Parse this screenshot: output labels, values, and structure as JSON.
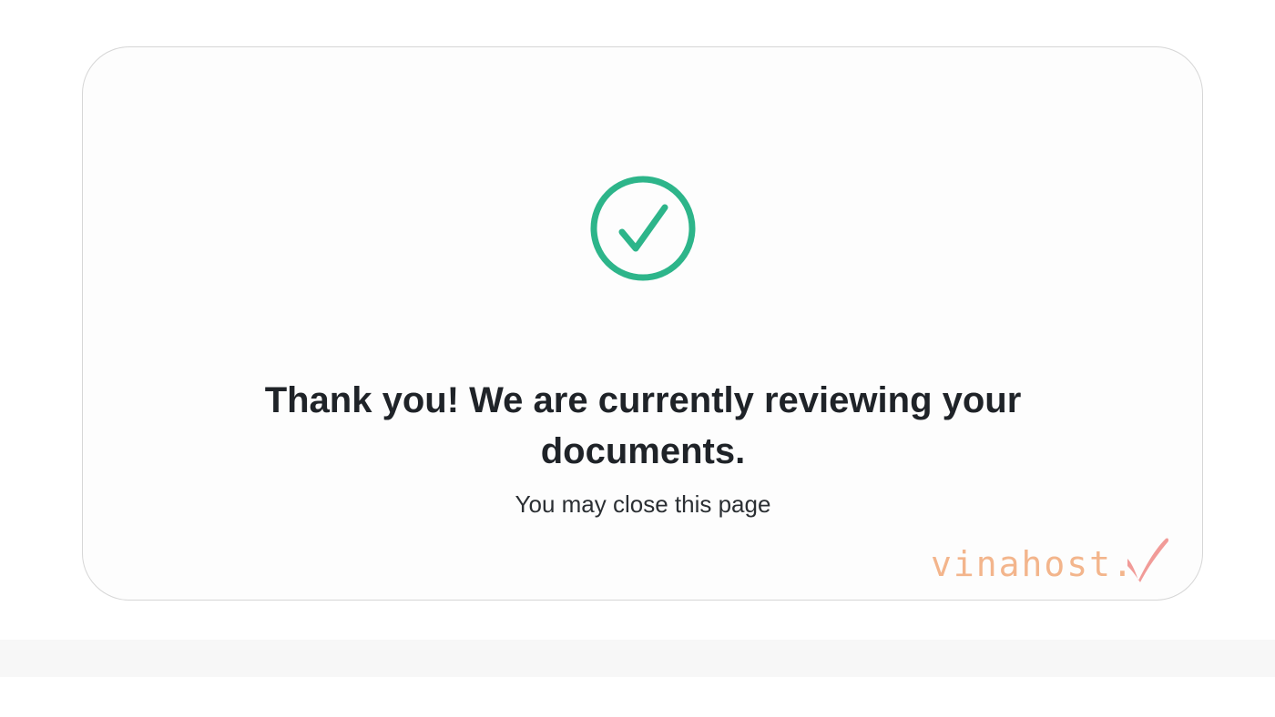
{
  "colors": {
    "accent": "#2db58a",
    "title": "#1f2328",
    "subtitle": "#2b2f33",
    "watermark": "#f2a979",
    "watermark_mark": "#ef8a86"
  },
  "status": {
    "icon": "check-circle-icon",
    "title": "Thank you! We are currently reviewing your documents.",
    "subtitle": "You may close this page"
  },
  "watermark": {
    "text": "vinahost."
  }
}
